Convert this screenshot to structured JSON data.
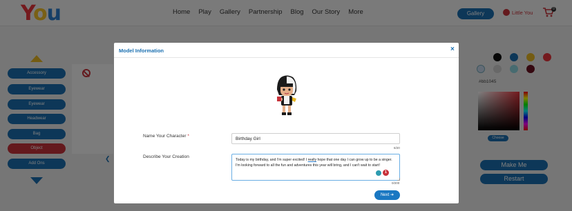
{
  "header": {
    "logo": [
      "Y",
      "o",
      "u"
    ],
    "nav": [
      "Home",
      "Play",
      "Gallery",
      "Partnership",
      "Blog",
      "Our Story",
      "More"
    ],
    "gallery_button": "Gallery",
    "user_name": "Little You",
    "cart_count": "0"
  },
  "app": {
    "categories": [
      {
        "label": "Accessory",
        "active": false
      },
      {
        "label": "Eyewear",
        "active": false
      },
      {
        "label": "Eyewear",
        "active": false
      },
      {
        "label": "Headwear",
        "active": false
      },
      {
        "label": "Bag",
        "active": false
      },
      {
        "label": "Object",
        "active": true
      },
      {
        "label": "Add Ons",
        "active": false
      }
    ],
    "swatches": [
      "#111111",
      "#1a6fb0",
      "#e8b825",
      "#e8343c",
      "#c9d9ec",
      "#d0d0d0",
      "#8fd6e0",
      "#6a1020"
    ],
    "hex_value": "#bb1045",
    "choose_label": "Choose",
    "make_me_label": "Make Me",
    "restart_label": "Restart"
  },
  "modal": {
    "title": "Model Information",
    "close_glyph": "×",
    "name_label": "Name Your Character",
    "name_required": "*",
    "name_value": "Birthday Girl",
    "name_counter": "6/20",
    "desc_label": "Describe Your Creation",
    "desc_text_1": "Today is my birthday, and I'm super excited! I ",
    "desc_text_underlined": "really",
    "desc_text_2": " hope that one day I can grow up to be a singer. I'm looking forward to all the fun and adventures this year will bring, and I can't wait to start!",
    "desc_counter": "0/200",
    "grammar_badge": "1",
    "next_label": "Next"
  }
}
